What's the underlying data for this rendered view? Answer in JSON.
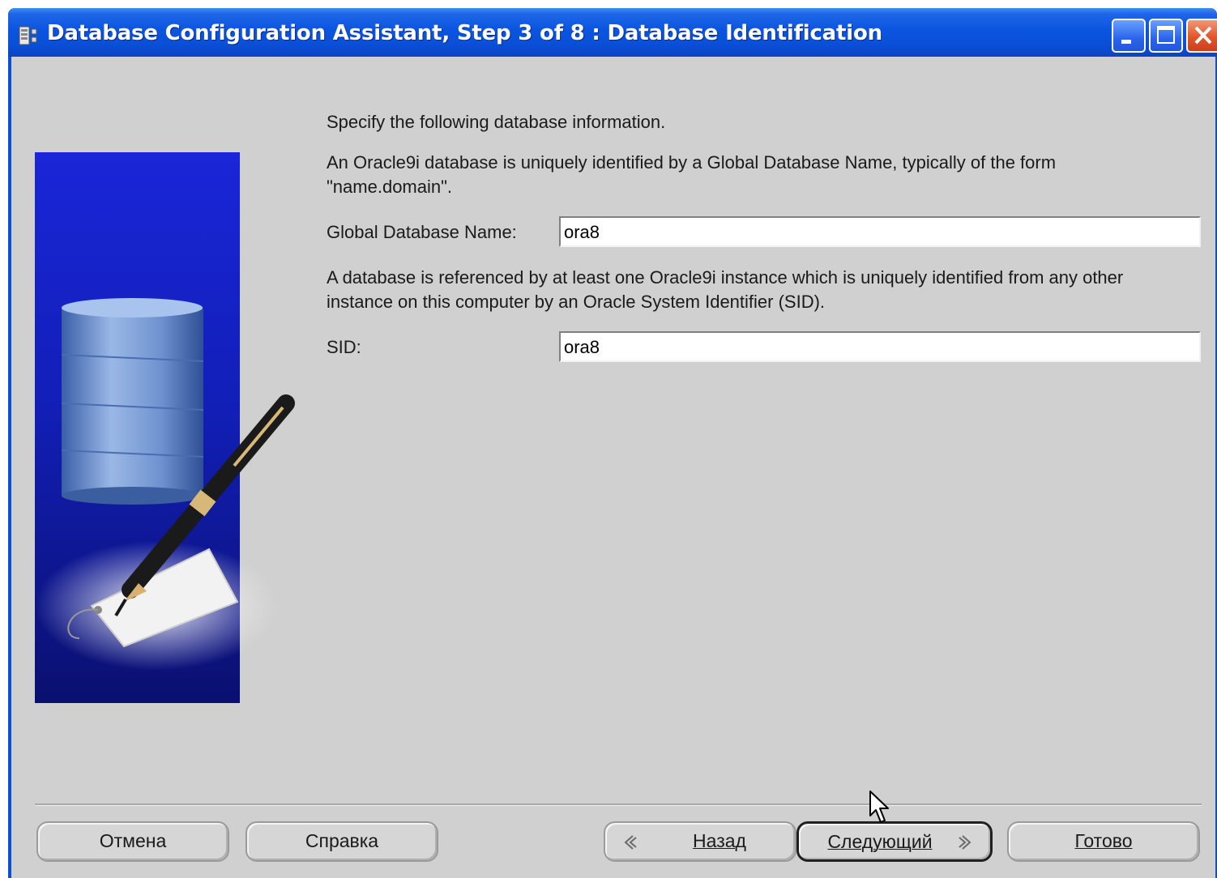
{
  "window": {
    "title": "Database Configuration Assistant, Step 3 of 8 : Database Identification"
  },
  "content": {
    "intro": "Specify the following database information.",
    "global_desc": "An Oracle9i database is uniquely identified by a Global Database Name, typically of the form \"name.domain\".",
    "global_name_label": "Global Database Name:",
    "global_name_value": "ora8",
    "sid_desc": "A database is referenced by at least one Oracle9i instance which is uniquely identified from any other instance on this computer by an Oracle System Identifier (SID).",
    "sid_label": "SID:",
    "sid_value": "ora8"
  },
  "buttons": {
    "cancel": "Отмена",
    "help": "Справка",
    "back": "Назад",
    "next": "Следующий",
    "finish": "Готово"
  },
  "icons": [
    "app-icon",
    "minimize-icon",
    "maximize-icon",
    "close-icon",
    "back-arrow-icon",
    "next-arrow-icon",
    "mouse-cursor-icon"
  ],
  "colors": {
    "titlebar": "#0a55e0",
    "client_bg": "#d0d0d0",
    "side_panel": "#121fb8"
  }
}
